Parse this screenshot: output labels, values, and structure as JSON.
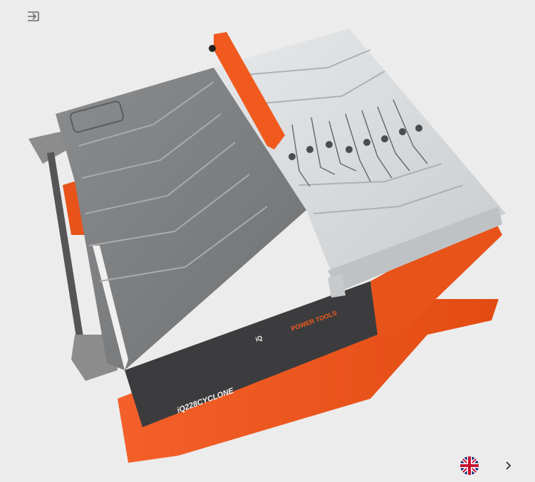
{
  "viewer": {
    "model_brand": "iQ",
    "model_name": "iQ228CYCLONE",
    "panel_tagline": "POWER TOOLS"
  },
  "controls": {
    "expand_icon": "expand-panel-icon",
    "language_flag_icon": "uk-flag-icon",
    "language_next_icon": "chevron-right-icon"
  },
  "colors": {
    "accent_orange": "#f25a1c",
    "table_grey": "#7a7c7e",
    "table_light": "#d6d8da",
    "frame_grey": "#8e8e8e",
    "background": "#ececec"
  }
}
